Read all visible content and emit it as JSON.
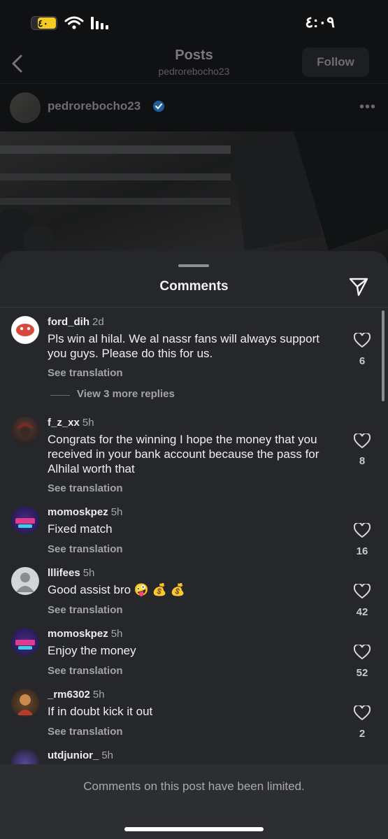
{
  "status_bar": {
    "battery_label": "٤٠",
    "time": "٤:٠٩"
  },
  "header": {
    "title": "Posts",
    "subtitle": "pedrorebocho23",
    "follow_label": "Follow"
  },
  "post": {
    "author": "pedrorebocho23"
  },
  "sheet": {
    "title": "Comments"
  },
  "comments": [
    {
      "user": "ford_dih",
      "time": "2d",
      "text": "Pls win al hilal. We al nassr fans will always support you guys. Please do this for us.",
      "see_translation": "See translation",
      "likes": "6",
      "replies_label": "View 3 more replies"
    },
    {
      "user": "f_z_xx",
      "time": "5h",
      "text": "Congrats for the winning I hope the money that you received in your bank account because the pass for Alhilal worth that",
      "see_translation": "See translation",
      "likes": "8"
    },
    {
      "user": "momoskpez",
      "time": "5h",
      "text": "Fixed match",
      "see_translation": "See translation",
      "likes": "16"
    },
    {
      "user": "lllifees",
      "time": "5h",
      "text": "Good assist bro 🤪 💰 💰",
      "see_translation": "See translation",
      "likes": "42"
    },
    {
      "user": "momoskpez",
      "time": "5h",
      "text": "Enjoy the money",
      "see_translation": "See translation",
      "likes": "52"
    },
    {
      "user": "_rm6302",
      "time": "5h",
      "text": "If in doubt kick it out",
      "see_translation": "See translation",
      "likes": "2"
    },
    {
      "user": "utdjunior_",
      "time": "5h"
    }
  ],
  "footer": {
    "notice": "Comments on this post have been limited."
  }
}
